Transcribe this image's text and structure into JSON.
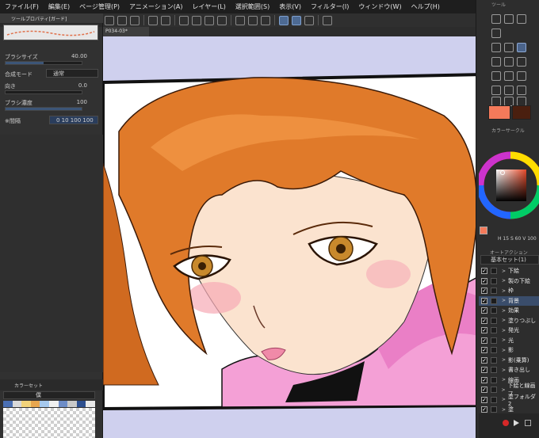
{
  "menu": [
    "ファイル(F)",
    "編集(E)",
    "ページ管理(P)",
    "アニメーション(A)",
    "レイヤー(L)",
    "選択範囲(S)",
    "表示(V)",
    "フィルター(I)",
    "ウィンドウ(W)",
    "ヘルプ(H)"
  ],
  "left_panel": {
    "tab": "ツールプロパティ[ガード]",
    "props": [
      {
        "label": "ブラシサイズ",
        "value": "40.00",
        "level": 0.5
      },
      {
        "label": "合成モード",
        "value": "通常"
      },
      {
        "label": "向き",
        "value": "0.0",
        "level": 0.0
      },
      {
        "label": "ブラシ濃度",
        "value": "100",
        "level": 1.0
      },
      {
        "label": "※間隔",
        "value": "0 10 100 100"
      }
    ],
    "colorset": {
      "tab": "カラーセット",
      "selected": "僕"
    }
  },
  "doc_tab": "P034-03*",
  "right_panel": {
    "tool_header": "ツール",
    "fg_color": "#f47a5a",
    "bg_color": "#4a1f0f",
    "wheel_header": "カラーサークル",
    "hsv_readout": "H 15  S 60  V 100",
    "auto_action_header": "オートアクション",
    "layer_set": "基本セット(1)",
    "layers": [
      {
        "name": "下絵",
        "selected": false
      },
      {
        "name": "製の下絵",
        "selected": false
      },
      {
        "name": "枠",
        "selected": false
      },
      {
        "name": "背景",
        "selected": true
      },
      {
        "name": "効果",
        "selected": false
      },
      {
        "name": "塗りつぶし",
        "selected": false
      },
      {
        "name": "発光",
        "selected": false
      },
      {
        "name": "光",
        "selected": false
      },
      {
        "name": "影",
        "selected": false
      },
      {
        "name": "影(乗算)",
        "selected": false
      },
      {
        "name": "書き出し",
        "selected": false
      },
      {
        "name": "線画",
        "selected": false
      },
      {
        "name": "下絵と線画フ",
        "selected": false
      },
      {
        "name": "塗フォルダ2",
        "selected": false
      },
      {
        "name": "塗",
        "selected": false
      }
    ]
  },
  "colors": {
    "canvas_bg": "#cfd0ee",
    "hair": "#e07a2a",
    "skin": "#fbe3cf",
    "hoodie": "#f4a0d6",
    "selection": "#3a4d6b"
  }
}
